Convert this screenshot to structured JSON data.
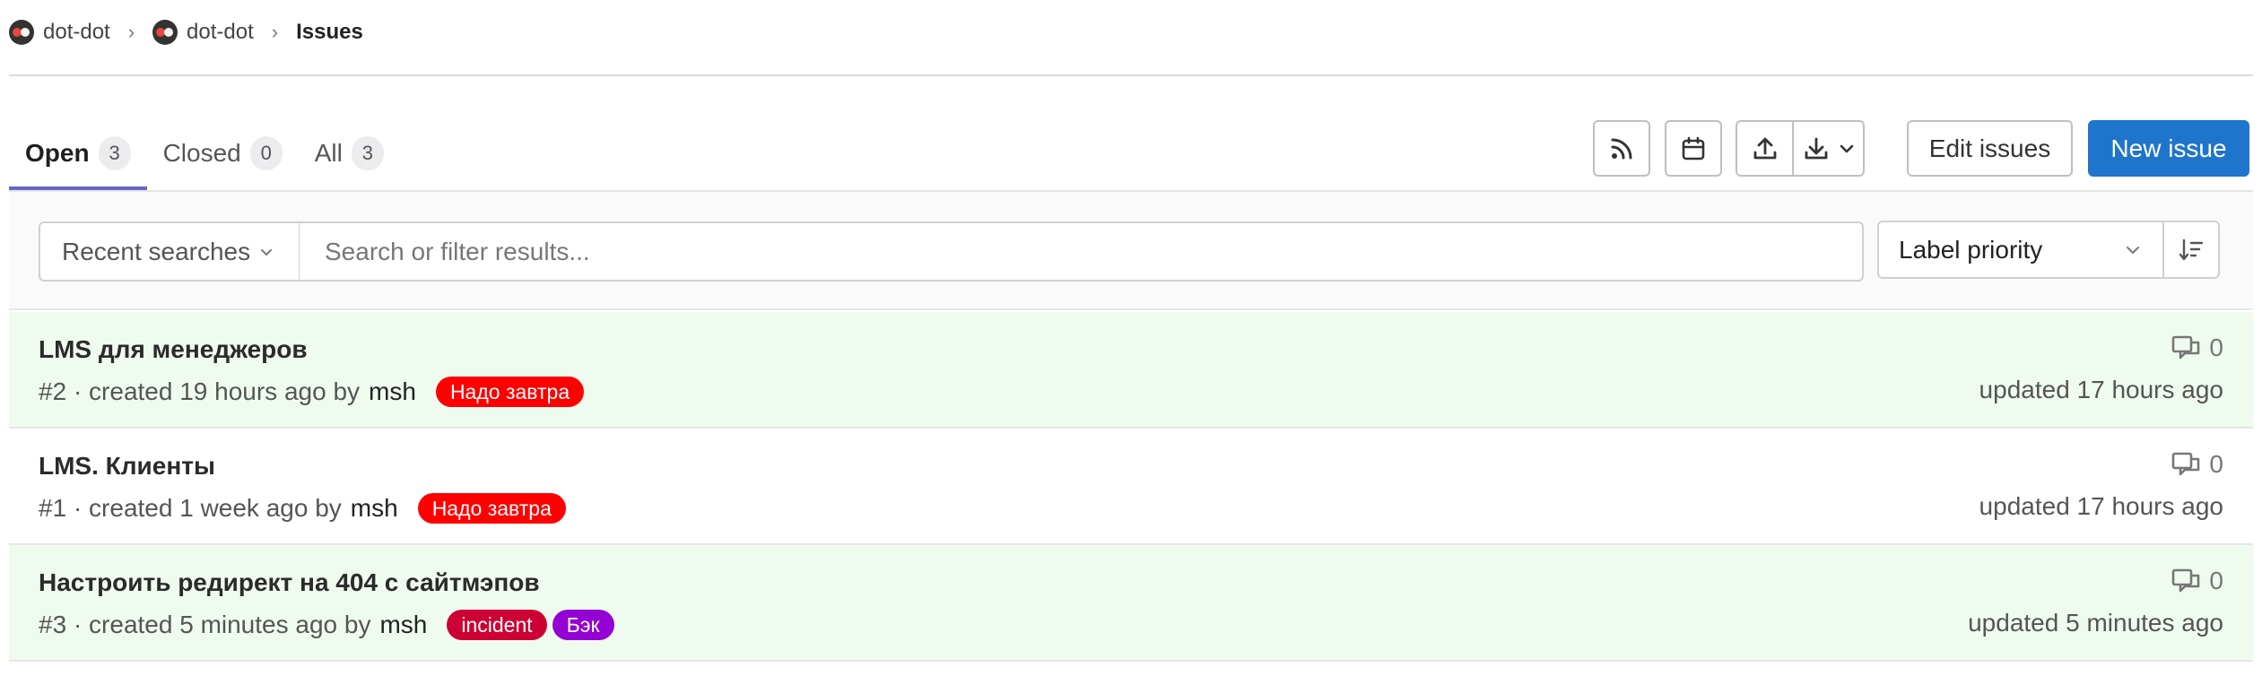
{
  "breadcrumb": {
    "items": [
      {
        "label": "dot-dot"
      },
      {
        "label": "dot-dot"
      }
    ],
    "current": "Issues"
  },
  "tabs": [
    {
      "label": "Open",
      "count": "3"
    },
    {
      "label": "Closed",
      "count": "0"
    },
    {
      "label": "All",
      "count": "3"
    }
  ],
  "actions": {
    "rss_icon": "rss-icon",
    "calendar_icon": "calendar-icon",
    "export_icon": "export-icon",
    "import_icon": "import-icon",
    "edit_label": "Edit issues",
    "new_label": "New issue"
  },
  "filter": {
    "recent_label": "Recent searches",
    "search_placeholder": "Search or filter results...",
    "sort_label": "Label priority",
    "sort_dir_icon": "sort-lowest-icon"
  },
  "issues": [
    {
      "title": "LMS для менеджеров",
      "ref": "#2",
      "created": "· created 19 hours ago by",
      "author": "msh",
      "labels": [
        {
          "text": "Надо завтра",
          "color": "#ff0000"
        }
      ],
      "comments": "0",
      "updated": "updated 17 hours ago"
    },
    {
      "title": "LMS. Клиенты",
      "ref": "#1",
      "created": "· created 1 week ago by",
      "author": "msh",
      "labels": [
        {
          "text": "Надо завтра",
          "color": "#ff0000"
        }
      ],
      "comments": "0",
      "updated": "updated 17 hours ago"
    },
    {
      "title": "Настроить редирект на 404 с сайтмэпов",
      "ref": "#3",
      "created": "· created 5 minutes ago by",
      "author": "msh",
      "labels": [
        {
          "text": "incident",
          "color": "#cc0033"
        },
        {
          "text": "Бэк",
          "color": "#9400d3"
        }
      ],
      "comments": "0",
      "updated": "updated 5 minutes ago"
    }
  ],
  "colors": {
    "primary": "#1f75cb",
    "active_tab_underline": "#6666c4",
    "highlight_row": "#f0fbef"
  }
}
